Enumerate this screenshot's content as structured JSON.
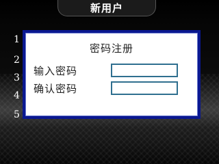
{
  "header": {
    "title": "新用户"
  },
  "menu": {
    "numbers": [
      "1",
      "2",
      "3",
      "4",
      "5"
    ]
  },
  "dialog": {
    "title": "密码注册",
    "fields": [
      {
        "label": "输入密码",
        "value": ""
      },
      {
        "label": "确认密码",
        "value": ""
      }
    ]
  },
  "colors": {
    "dialog_border": "#0a1890",
    "input_border": "#2f6f8f",
    "background": "#000000"
  }
}
